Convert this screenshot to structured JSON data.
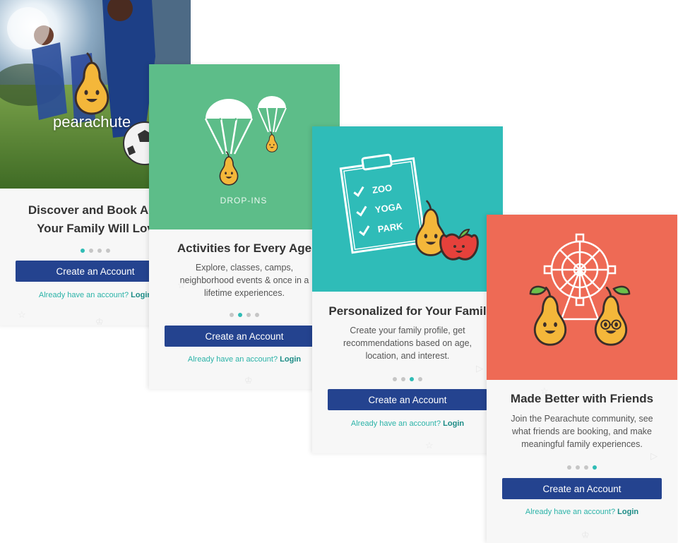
{
  "colors": {
    "teal": "#2fbcb5",
    "navy": "#24438f",
    "green": "#5dbd89",
    "turquoise": "#2fbcb8",
    "coral": "#ee6a55",
    "pear": "#f4b73a"
  },
  "screens": [
    {
      "brand_name": "pearachute",
      "title_lines": [
        "Discover and Book Acti",
        "Your Family Will Lov"
      ],
      "dots_active": 0,
      "cta_label": "Create an Account",
      "login_prefix": "Already have an account?",
      "login_link": "Login"
    },
    {
      "caption": "DROP-INS",
      "title": "Activities for Every Age",
      "desc_lines": [
        "Explore, classes, camps,",
        "neighborhood events & once in a",
        "lifetime experiences."
      ],
      "dots_active": 1,
      "cta_label": "Create an Account",
      "login_prefix": "Already have an account?",
      "login_link": "Login"
    },
    {
      "checklist": [
        "ZOO",
        "YOGA",
        "PARK"
      ],
      "title": "Personalized for Your Famil",
      "desc_lines": [
        "Create your family profile, get",
        "recommendations based on age,",
        "location, and interest."
      ],
      "dots_active": 2,
      "cta_label": "Create an Account",
      "login_prefix": "Already have an account?",
      "login_link": "Login"
    },
    {
      "title": "Made Better with Friends",
      "desc_lines": [
        "Join the Pearachute community, see",
        "what friends are booking, and make",
        "meaningful family experiences."
      ],
      "dots_active": 3,
      "cta_label": "Create an Account",
      "login_prefix": "Already have an account?",
      "login_link": "Login"
    }
  ]
}
